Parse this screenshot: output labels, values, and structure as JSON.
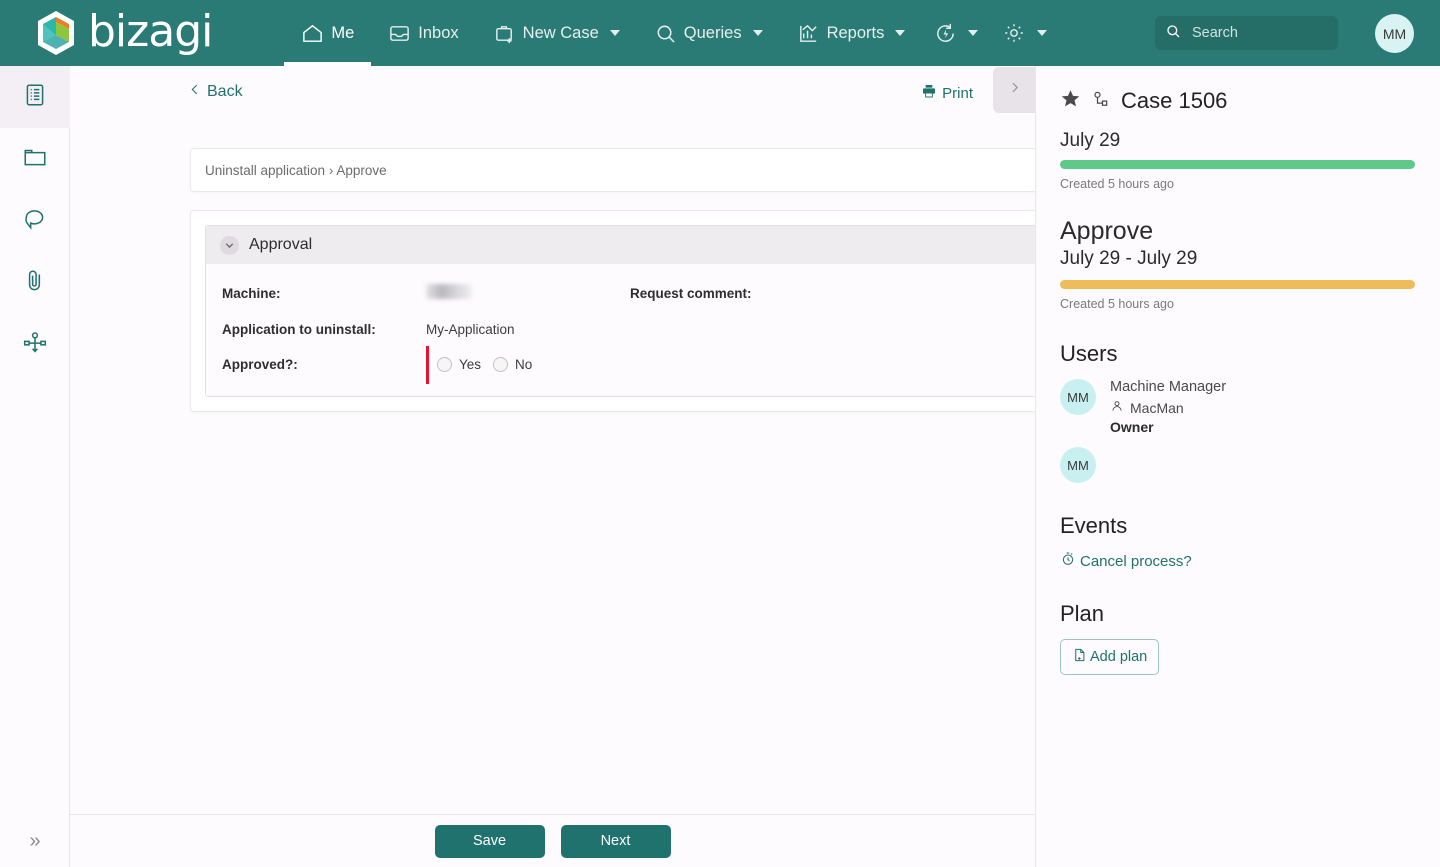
{
  "header": {
    "logo_text": "bizagi",
    "nav": [
      {
        "label": "Me",
        "icon": "home-icon",
        "active": true,
        "caret": false
      },
      {
        "label": "Inbox",
        "icon": "inbox-icon",
        "active": false,
        "caret": false
      },
      {
        "label": "New Case",
        "icon": "briefcase-plus-icon",
        "active": false,
        "caret": true
      },
      {
        "label": "Queries",
        "icon": "search-icon",
        "active": false,
        "caret": true
      },
      {
        "label": "Reports",
        "icon": "chart-icon",
        "active": false,
        "caret": true
      }
    ],
    "icon_buttons": [
      {
        "icon": "refresh-bolt-icon",
        "caret": true
      },
      {
        "icon": "gear-icon",
        "caret": true
      }
    ],
    "search": {
      "placeholder": "Search",
      "value": ""
    },
    "avatar_initials": "MM",
    "background_color": "#2a7b75"
  },
  "rail": {
    "items": [
      {
        "icon": "case-summary-icon",
        "active": true
      },
      {
        "icon": "folder-icon",
        "active": false
      },
      {
        "icon": "comment-icon",
        "active": false
      },
      {
        "icon": "paperclip-icon",
        "active": false
      },
      {
        "icon": "process-diagram-icon",
        "active": false
      }
    ],
    "expand_icon": "double-chevron-right-icon"
  },
  "toolbar": {
    "back_label": "Back",
    "print_label": "Print",
    "panel_toggle_icon": "chevron-right-icon"
  },
  "breadcrumb": "Uninstall application › Approve",
  "form": {
    "section_title": "Approval",
    "fields": {
      "machine_label": "Machine:",
      "machine_value": "",
      "request_comment_label": "Request comment:",
      "request_comment_value": "",
      "application_label": "Application to uninstall:",
      "application_value": "My-Application",
      "approved_label": "Approved?:",
      "radio_yes": "Yes",
      "radio_no": "No",
      "required_marker_color": "#e8112d"
    }
  },
  "actions": {
    "save_label": "Save",
    "next_label": "Next"
  },
  "case_panel": {
    "favorite_icon": "star-icon",
    "process_icon": "process-node-icon",
    "title": "Case 1506",
    "stages": [
      {
        "name": "July 29",
        "bar_color": "#5fc98a",
        "note": "Created 5 hours ago"
      },
      {
        "heading": "Approve",
        "name": "July 29 - July 29",
        "bar_color": "#eebc5a",
        "note": "Created 5 hours ago"
      }
    ],
    "users_title": "Users",
    "users": [
      {
        "initials": "MM",
        "name": "Machine Manager",
        "login": "MacMan",
        "role": "Owner",
        "login_icon": "person-icon"
      },
      {
        "initials": "MM",
        "name": "",
        "login": "",
        "role": ""
      }
    ],
    "events_title": "Events",
    "event_link": "Cancel process?",
    "event_icon": "timer-icon",
    "plan_title": "Plan",
    "add_plan_label": "Add plan",
    "add_plan_icon": "document-add-icon"
  }
}
